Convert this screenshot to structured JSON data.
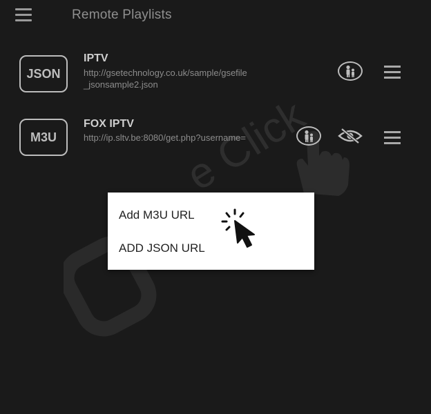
{
  "header": {
    "title": "Remote Playlists",
    "menu_icon": "hamburger-menu-icon"
  },
  "playlists": [
    {
      "badge": "JSON",
      "name": "IPTV",
      "url_line1": "http://gsetechnology.co.uk/sample/gsefile",
      "url_line2": "_jsonsample2.json",
      "icons": [
        "parental-control-icon",
        "drag-handle-icon"
      ]
    },
    {
      "badge": "M3U",
      "name": "FOX IPTV",
      "url_line1": "http://ip.sltv.be:8080/get.php?username=",
      "icons": [
        "parental-control-icon",
        "hidden-eye-icon",
        "drag-handle-icon"
      ]
    }
  ],
  "popup_menu": {
    "items": [
      "Add M3U URL",
      "ADD JSON URL"
    ]
  },
  "colors": {
    "background": "#1a1a1a",
    "text_primary": "#cfcfcf",
    "text_secondary": "#8c8c8c",
    "popup_bg": "#ffffff"
  }
}
